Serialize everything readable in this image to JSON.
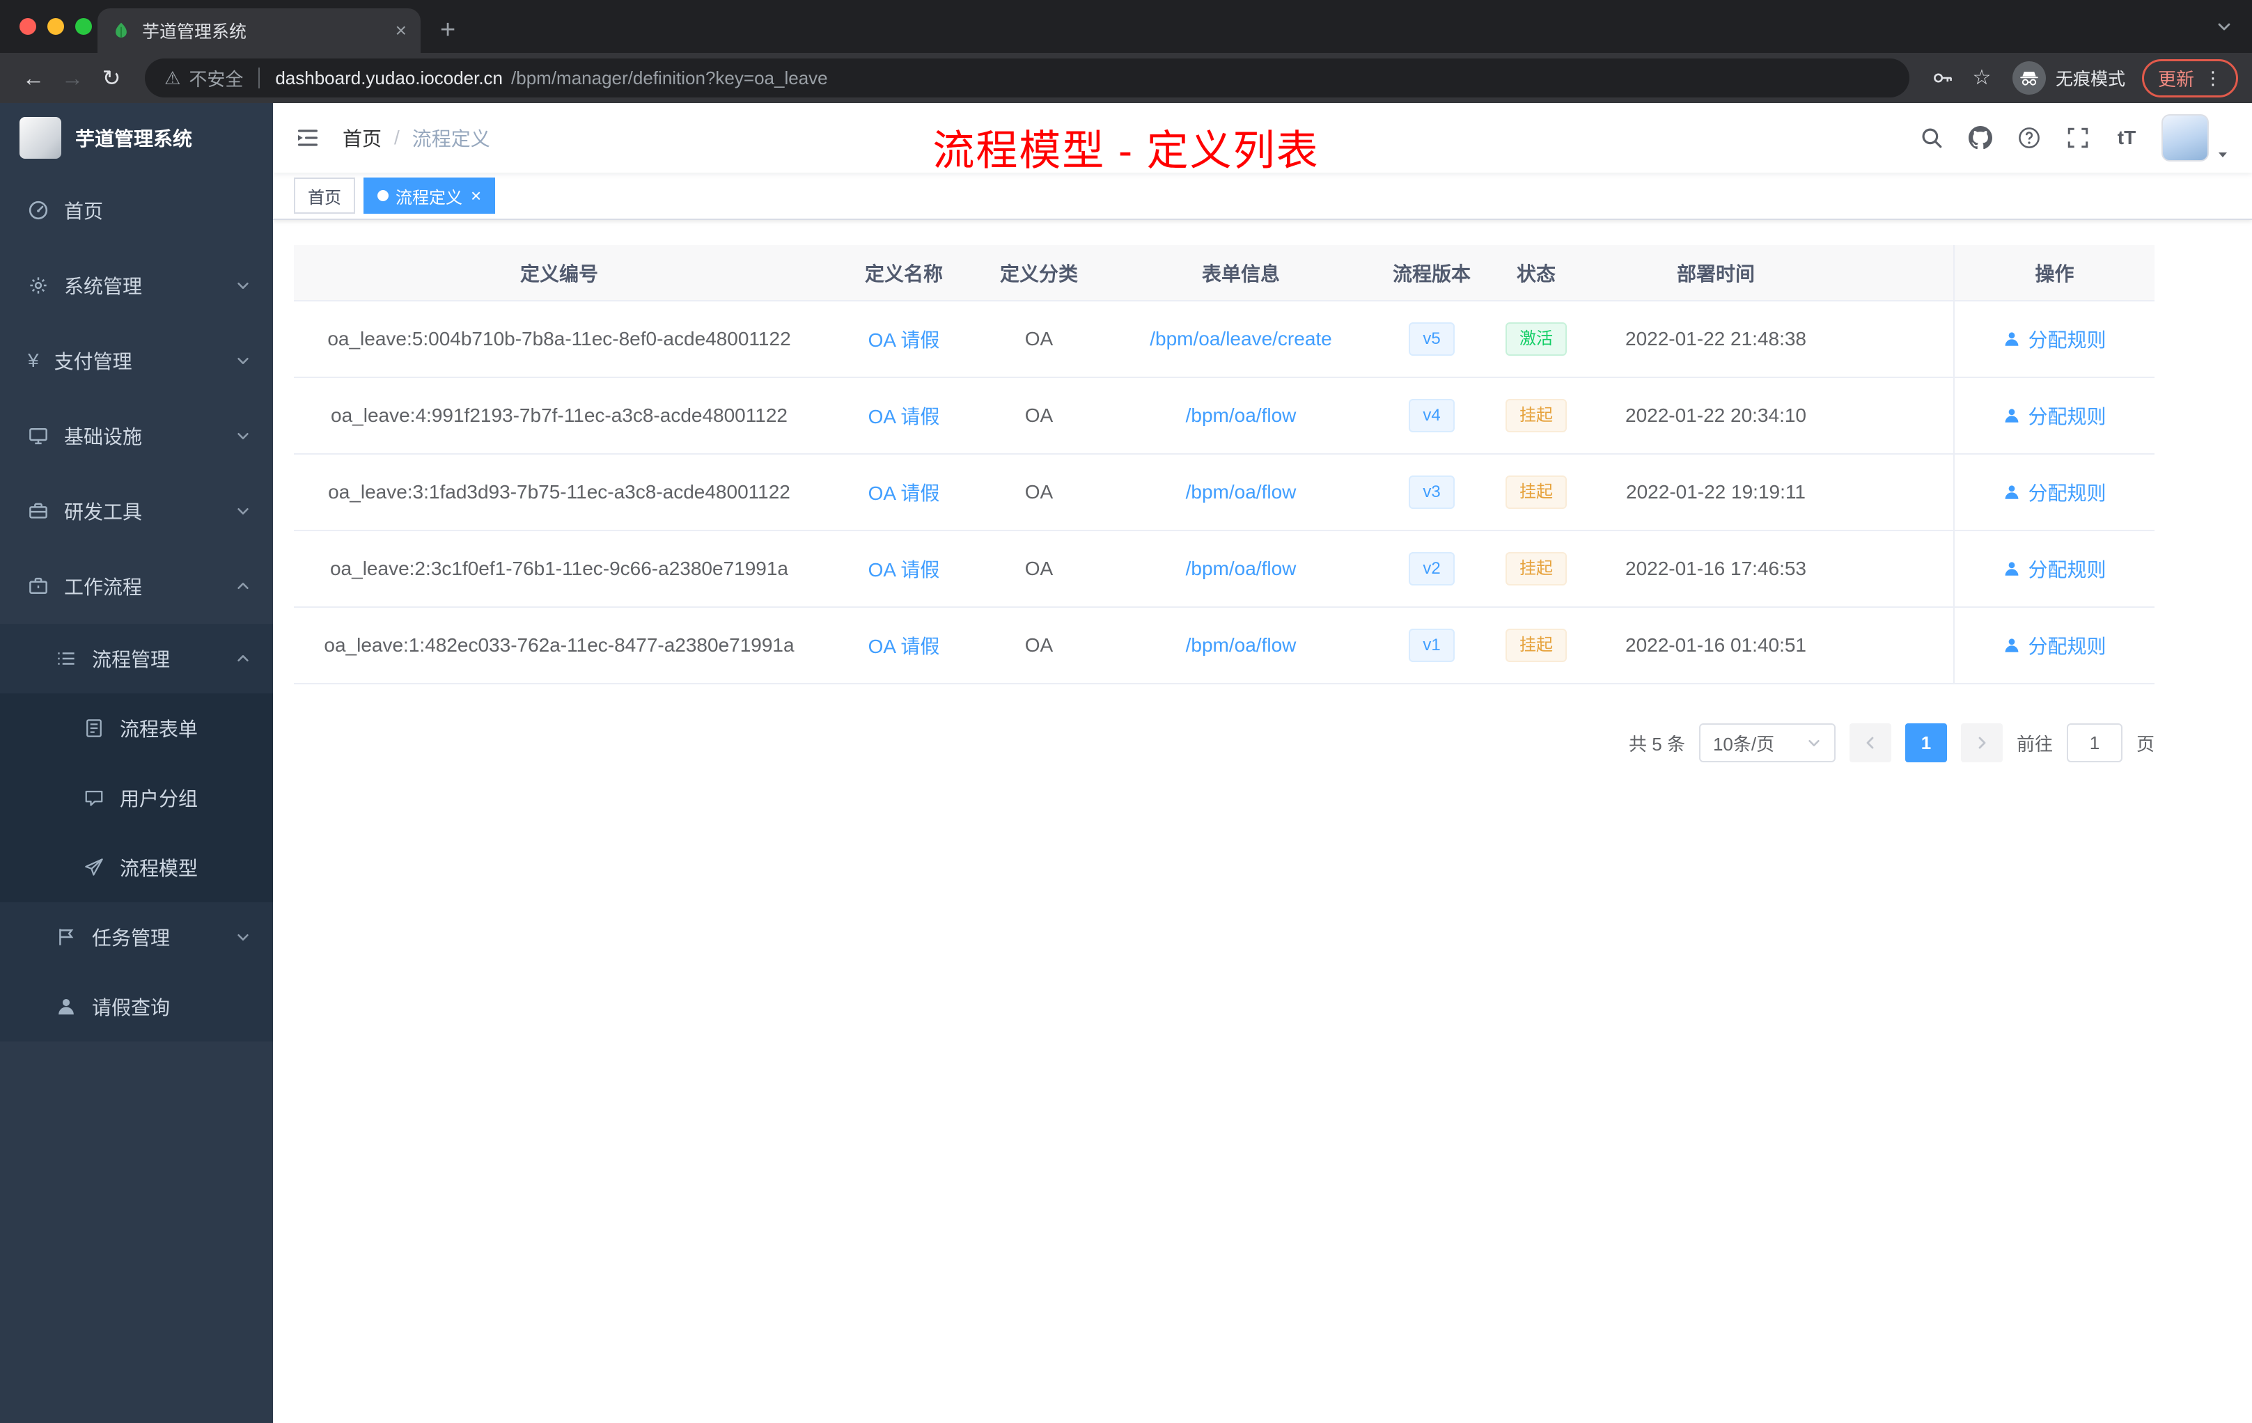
{
  "colors": {
    "accent": "#409eff",
    "annotation": "#ff0000",
    "success": "#13ce66",
    "warning": "#e6a23c",
    "sidebar_bg": "#2d3a4b"
  },
  "browser": {
    "tab_title": "芋道管理系统",
    "security_label": "不安全",
    "url_host": "dashboard.yudao.iocoder.cn",
    "url_path": "/bpm/manager/definition?key=oa_leave",
    "incognito_label": "无痕模式",
    "update_label": "更新"
  },
  "sidebar": {
    "logo_title": "芋道管理系统",
    "items": [
      {
        "key": "home",
        "label": "首页",
        "icon": "dashboard-icon",
        "level": 1
      },
      {
        "key": "system",
        "label": "系统管理",
        "icon": "gear-icon",
        "level": 1,
        "arrow": "down"
      },
      {
        "key": "payment",
        "label": "支付管理",
        "icon": "yen-icon",
        "level": 1,
        "arrow": "down"
      },
      {
        "key": "infrastructure",
        "label": "基础设施",
        "icon": "monitor-icon",
        "level": 1,
        "arrow": "down"
      },
      {
        "key": "dev-tools",
        "label": "研发工具",
        "icon": "toolbox-icon",
        "level": 1,
        "arrow": "down"
      },
      {
        "key": "workflow",
        "label": "工作流程",
        "icon": "briefcase-icon",
        "level": 1,
        "arrow": "up"
      },
      {
        "key": "process-management",
        "label": "流程管理",
        "icon": "list-icon",
        "level": 2,
        "arrow": "up"
      },
      {
        "key": "process-form",
        "label": "流程表单",
        "icon": "form-icon",
        "level": 3
      },
      {
        "key": "user-group",
        "label": "用户分组",
        "icon": "chat-icon",
        "level": 3
      },
      {
        "key": "process-model",
        "label": "流程模型",
        "icon": "send-icon",
        "level": 3
      },
      {
        "key": "task-management",
        "label": "任务管理",
        "icon": "flag-icon",
        "level": 2,
        "arrow": "down"
      },
      {
        "key": "leave-query",
        "label": "请假查询",
        "icon": "user-icon",
        "level": 2
      }
    ]
  },
  "navbar": {
    "breadcrumb": {
      "home": "首页",
      "separator": "/",
      "current": "流程定义"
    },
    "icons": [
      "search-icon",
      "github-icon",
      "question-icon",
      "fullscreen-icon",
      "fontsize-icon"
    ]
  },
  "annotation": {
    "text": "流程模型 - 定义列表"
  },
  "tags": {
    "items": [
      {
        "key": "home",
        "label": "首页",
        "active": false
      },
      {
        "key": "process-definition",
        "label": "流程定义",
        "active": true
      }
    ]
  },
  "table": {
    "columns": [
      "定义编号",
      "定义名称",
      "定义分类",
      "表单信息",
      "流程版本",
      "状态",
      "部署时间",
      "操作"
    ],
    "rows": [
      {
        "id": "oa_leave:5:004b710b-7b8a-11ec-8ef0-acde48001122",
        "name": "OA 请假",
        "category": "OA",
        "form": "/bpm/oa/leave/create",
        "version": "v5",
        "status": "激活",
        "status_type": "success",
        "deploy_time": "2022-01-22 21:48:38",
        "action": "分配规则"
      },
      {
        "id": "oa_leave:4:991f2193-7b7f-11ec-a3c8-acde48001122",
        "name": "OA 请假",
        "category": "OA",
        "form": "/bpm/oa/flow",
        "version": "v4",
        "status": "挂起",
        "status_type": "warning",
        "deploy_time": "2022-01-22 20:34:10",
        "action": "分配规则"
      },
      {
        "id": "oa_leave:3:1fad3d93-7b75-11ec-a3c8-acde48001122",
        "name": "OA 请假",
        "category": "OA",
        "form": "/bpm/oa/flow",
        "version": "v3",
        "status": "挂起",
        "status_type": "warning",
        "deploy_time": "2022-01-22 19:19:11",
        "action": "分配规则"
      },
      {
        "id": "oa_leave:2:3c1f0ef1-76b1-11ec-9c66-a2380e71991a",
        "name": "OA 请假",
        "category": "OA",
        "form": "/bpm/oa/flow",
        "version": "v2",
        "status": "挂起",
        "status_type": "warning",
        "deploy_time": "2022-01-16 17:46:53",
        "action": "分配规则"
      },
      {
        "id": "oa_leave:1:482ec033-762a-11ec-8477-a2380e71991a",
        "name": "OA 请假",
        "category": "OA",
        "form": "/bpm/oa/flow",
        "version": "v1",
        "status": "挂起",
        "status_type": "warning",
        "deploy_time": "2022-01-16 01:40:51",
        "action": "分配规则"
      }
    ]
  },
  "pagination": {
    "total": "共 5 条",
    "page_size": "10条/页",
    "active_page": "1",
    "goto_prefix": "前往",
    "goto_value": "1",
    "goto_suffix": "页"
  }
}
